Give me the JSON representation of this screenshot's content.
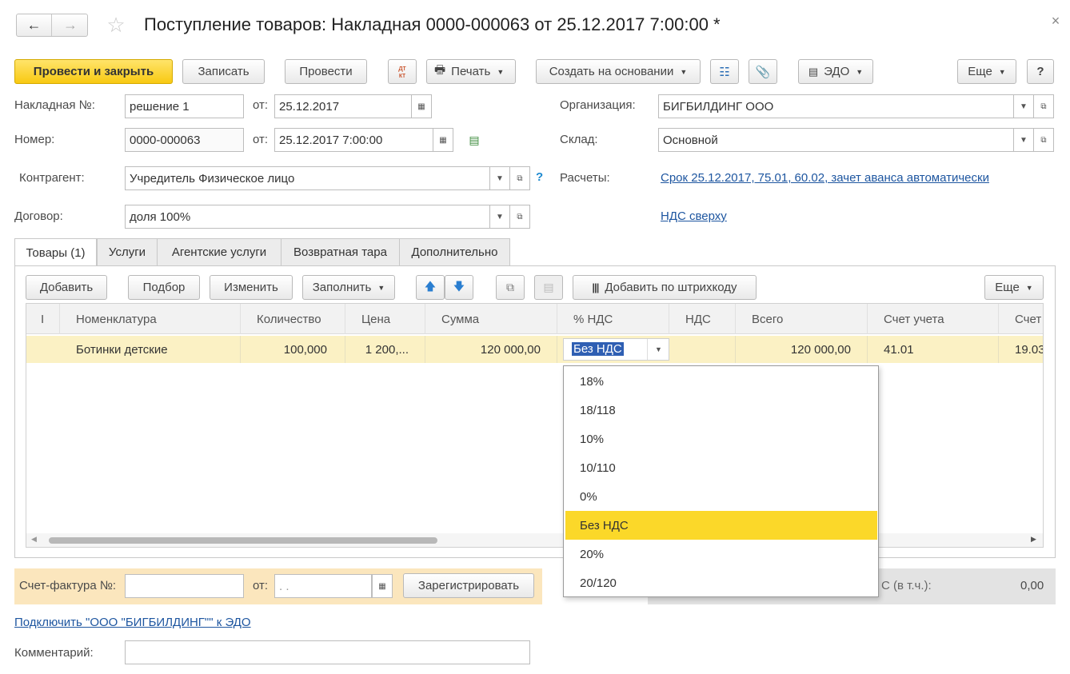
{
  "window": {
    "title": "Поступление товаров: Накладная 0000-000063 от 25.12.2017 7:00:00 *"
  },
  "toolbar": {
    "post_close": "Провести и закрыть",
    "save": "Записать",
    "post": "Провести",
    "print": "Печать",
    "create_based": "Создать на основании",
    "edo": "ЭДО",
    "more": "Еще",
    "help": "?"
  },
  "form": {
    "invoice_label": "Накладная  №:",
    "invoice_value": "решение 1",
    "from_label": "от:",
    "invoice_date": "25.12.2017",
    "number_label": "Номер:",
    "number_value": "0000-000063",
    "number_date": "25.12.2017  7:00:00",
    "counterparty_label": "Контрагент:",
    "counterparty_value": "Учредитель Физическое лицо",
    "contract_label": "Договор:",
    "contract_value": "доля 100%",
    "org_label": "Организация:",
    "org_value": "БИГБИЛДИНГ ООО",
    "warehouse_label": "Склад:",
    "warehouse_value": "Основной",
    "settlements_label": "Расчеты:",
    "settlements_link": "Срок 25.12.2017, 75.01, 60.02, зачет аванса автоматически",
    "vat_link": "НДС сверху"
  },
  "tabs": [
    "Товары (1)",
    "Услуги",
    "Агентские услуги",
    "Возвратная тара",
    "Дополнительно"
  ],
  "table_toolbar": {
    "add": "Добавить",
    "select": "Подбор",
    "edit": "Изменить",
    "fill": "Заполнить",
    "barcode": "Добавить по штрихкоду",
    "more": "Еще"
  },
  "table": {
    "columns": [
      "I",
      "Номенклатура",
      "Количество",
      "Цена",
      "Сумма",
      "% НДС",
      "НДС",
      "Всего",
      "Счет учета",
      "Счет"
    ],
    "rows": [
      {
        "name": "Ботинки детские",
        "qty": "100,000",
        "price": "1 200,...",
        "sum": "120 000,00",
        "vat_rate": "Без НДС",
        "vat": "",
        "total": "120 000,00",
        "account": "41.01",
        "account2": "19.03"
      }
    ]
  },
  "dropdown": {
    "options": [
      "18%",
      "18/118",
      "10%",
      "10/110",
      "0%",
      "Без НДС",
      "20%",
      "20/120"
    ],
    "selected": "Без НДС"
  },
  "footer": {
    "sf_label": "Счет-фактура №:",
    "sf_from": "от:",
    "sf_date": " .  .",
    "register": "Зарегистрировать",
    "total_label": "С (в т.ч.):",
    "total_value": "0,00",
    "edo_link": "Подключить \"ООО \"БИГБИЛДИНГ\"\" к ЭДО",
    "comment_label": "Комментарий:"
  },
  "colors": {
    "accent": "#f8c912",
    "row_highlight": "#fbf1c4",
    "link": "#1e56a0"
  }
}
